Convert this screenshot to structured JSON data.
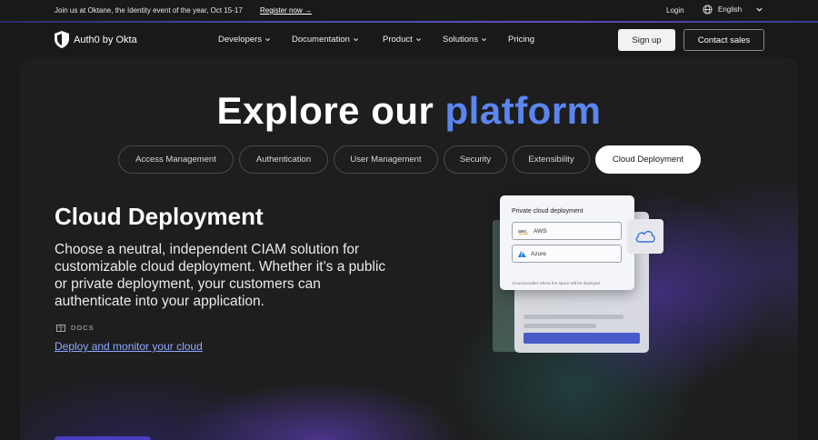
{
  "announcement": {
    "message": "Join us at Oktane, the Identity event of the year, Oct 15-17",
    "register_link": "Register now →",
    "login": "Login",
    "language": "English"
  },
  "nav": {
    "logo_text": "Auth0 by Okta",
    "items": [
      "Developers",
      "Documentation",
      "Product",
      "Solutions",
      "Pricing"
    ],
    "signup": "Sign up",
    "contact": "Contact sales"
  },
  "hero": {
    "title_part1": "Explore our",
    "title_part2": "platform"
  },
  "tabs": [
    "Access Management",
    "Authentication",
    "User Management",
    "Security",
    "Extensibility",
    "Cloud Deployment"
  ],
  "active_tab": "Cloud Deployment",
  "section": {
    "title": "Cloud Deployment",
    "description": "Choose a neutral, independent CIAM solution for customizable cloud deployment. Whether it’s a public or private deployment, your customers can authenticate into your application.",
    "docs_label": "DOCS",
    "docs_link": "Deploy and monitor your cloud"
  },
  "illustration": {
    "card_title": "Private cloud deployment",
    "option_1": "AWS",
    "option_2": "Azure",
    "hint": "Cloud provider where the space will be deployed."
  },
  "colors": {
    "background": "#191919",
    "accent_blue": "#5b86f0",
    "link": "#8fa8ff"
  }
}
